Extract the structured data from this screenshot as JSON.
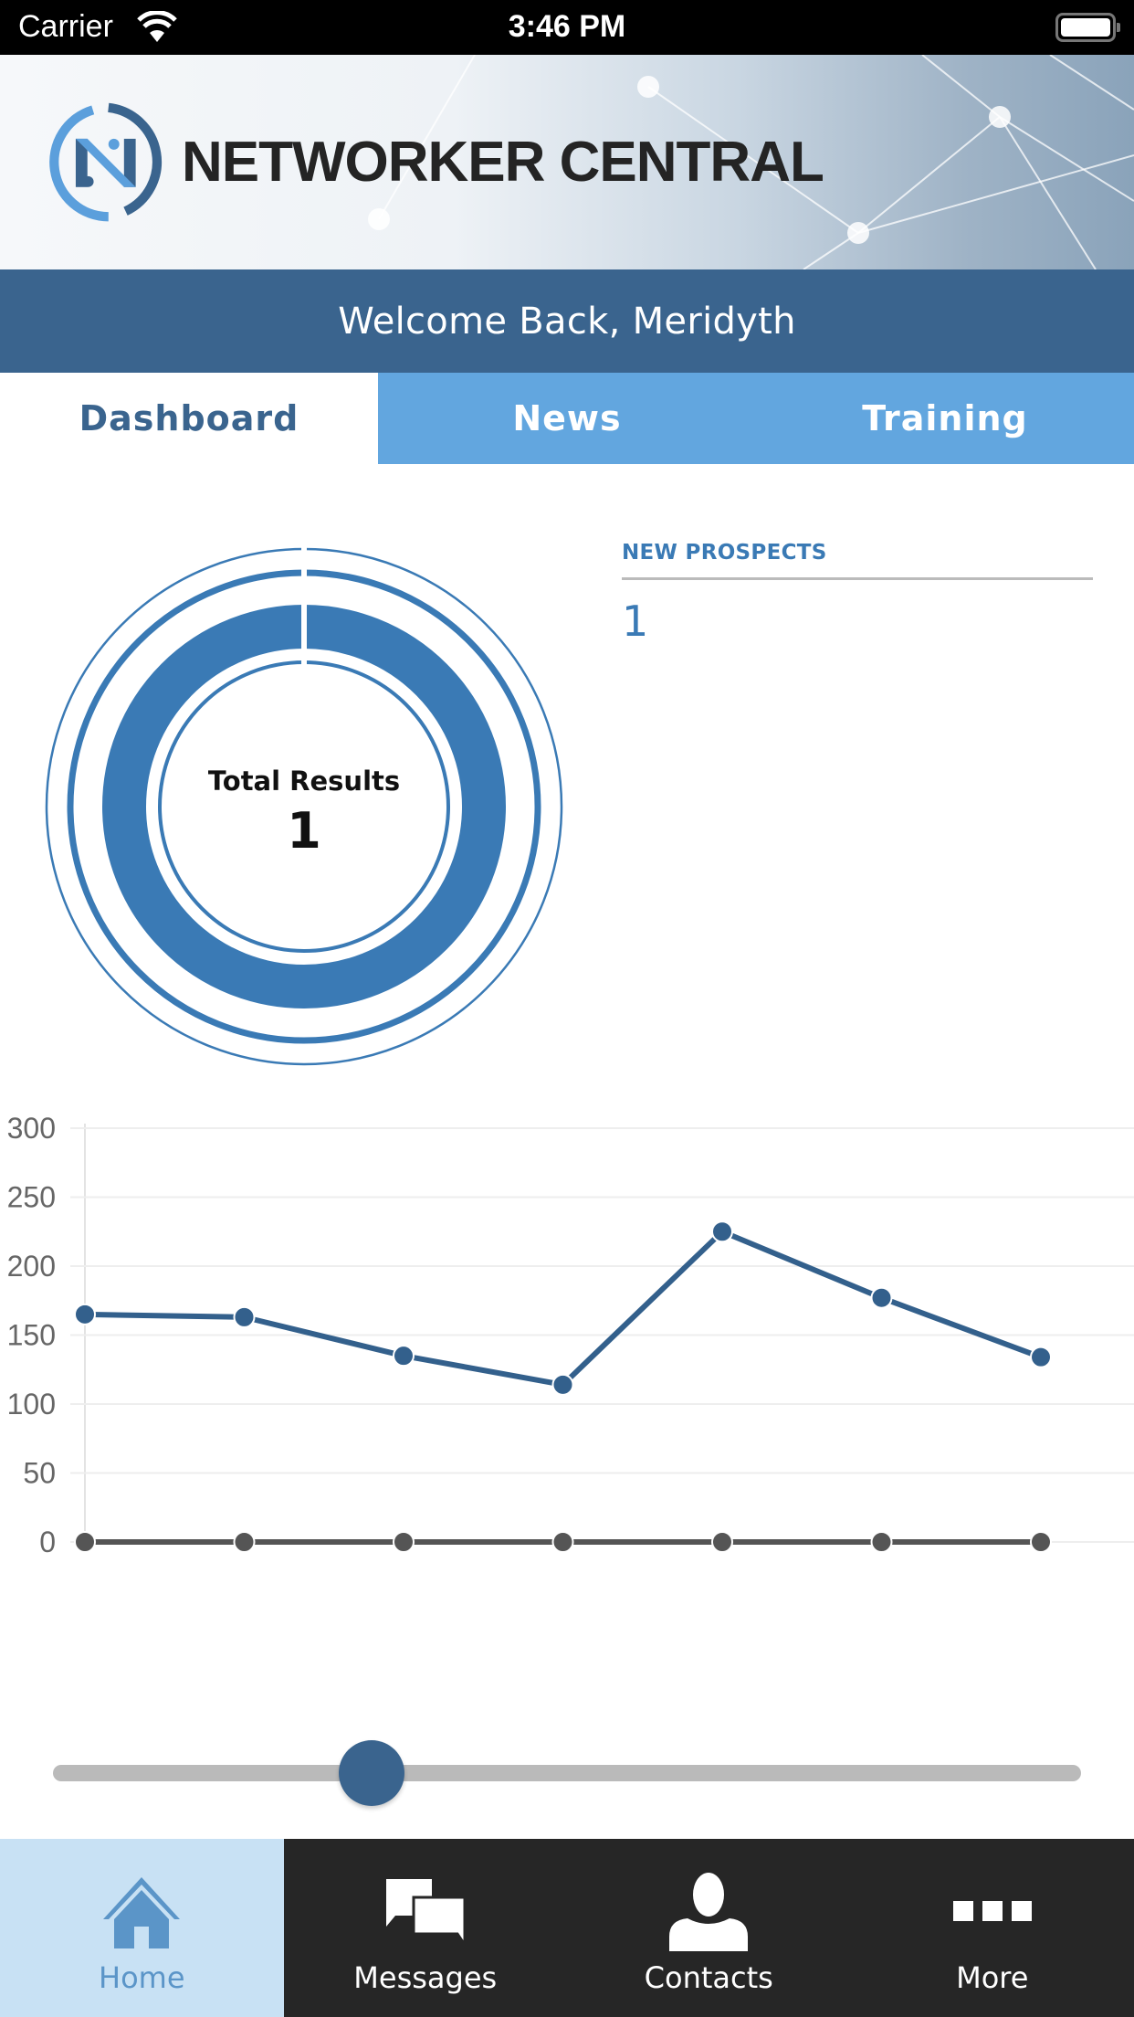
{
  "status_bar": {
    "carrier": "Carrier",
    "time": "3:46 PM"
  },
  "header": {
    "brand": "NETWORKER CENTRAL"
  },
  "welcome": "Welcome Back, Meridyth",
  "tabs": [
    {
      "label": "Dashboard",
      "active": true
    },
    {
      "label": "News",
      "active": false
    },
    {
      "label": "Training",
      "active": false
    }
  ],
  "donut": {
    "label": "Total Results",
    "value": "1"
  },
  "prospects": {
    "title": "NEW PROSPECTS",
    "value": "1"
  },
  "slider": {
    "value_fraction": 0.31
  },
  "bottom_nav": [
    {
      "label": "Home",
      "icon": "home-icon",
      "active": true
    },
    {
      "label": "Messages",
      "icon": "messages-icon",
      "active": false
    },
    {
      "label": "Contacts",
      "icon": "contact-person-icon",
      "active": false
    },
    {
      "label": "More",
      "icon": "more-icon",
      "active": false
    }
  ],
  "colors": {
    "primary": "#3a648e",
    "tab_blue": "#62a6df",
    "accent": "#3a7ab5",
    "series_gray": "#555555",
    "tabbar_bg": "#262626",
    "tabbar_active": "#c8e1f4"
  },
  "chart_data": {
    "type": "line",
    "title": "",
    "xlabel": "",
    "ylabel": "",
    "x": [
      1,
      2,
      3,
      4,
      5,
      6,
      7
    ],
    "yticks": [
      0,
      50,
      100,
      150,
      200,
      250,
      300
    ],
    "ylim": [
      0,
      300
    ],
    "grid": true,
    "series": [
      {
        "name": "series-1",
        "color": "#33608c",
        "values": [
          165,
          163,
          135,
          114,
          225,
          177,
          134
        ]
      },
      {
        "name": "series-2",
        "color": "#555555",
        "values": [
          0,
          0,
          0,
          0,
          0,
          0,
          0
        ]
      }
    ]
  }
}
